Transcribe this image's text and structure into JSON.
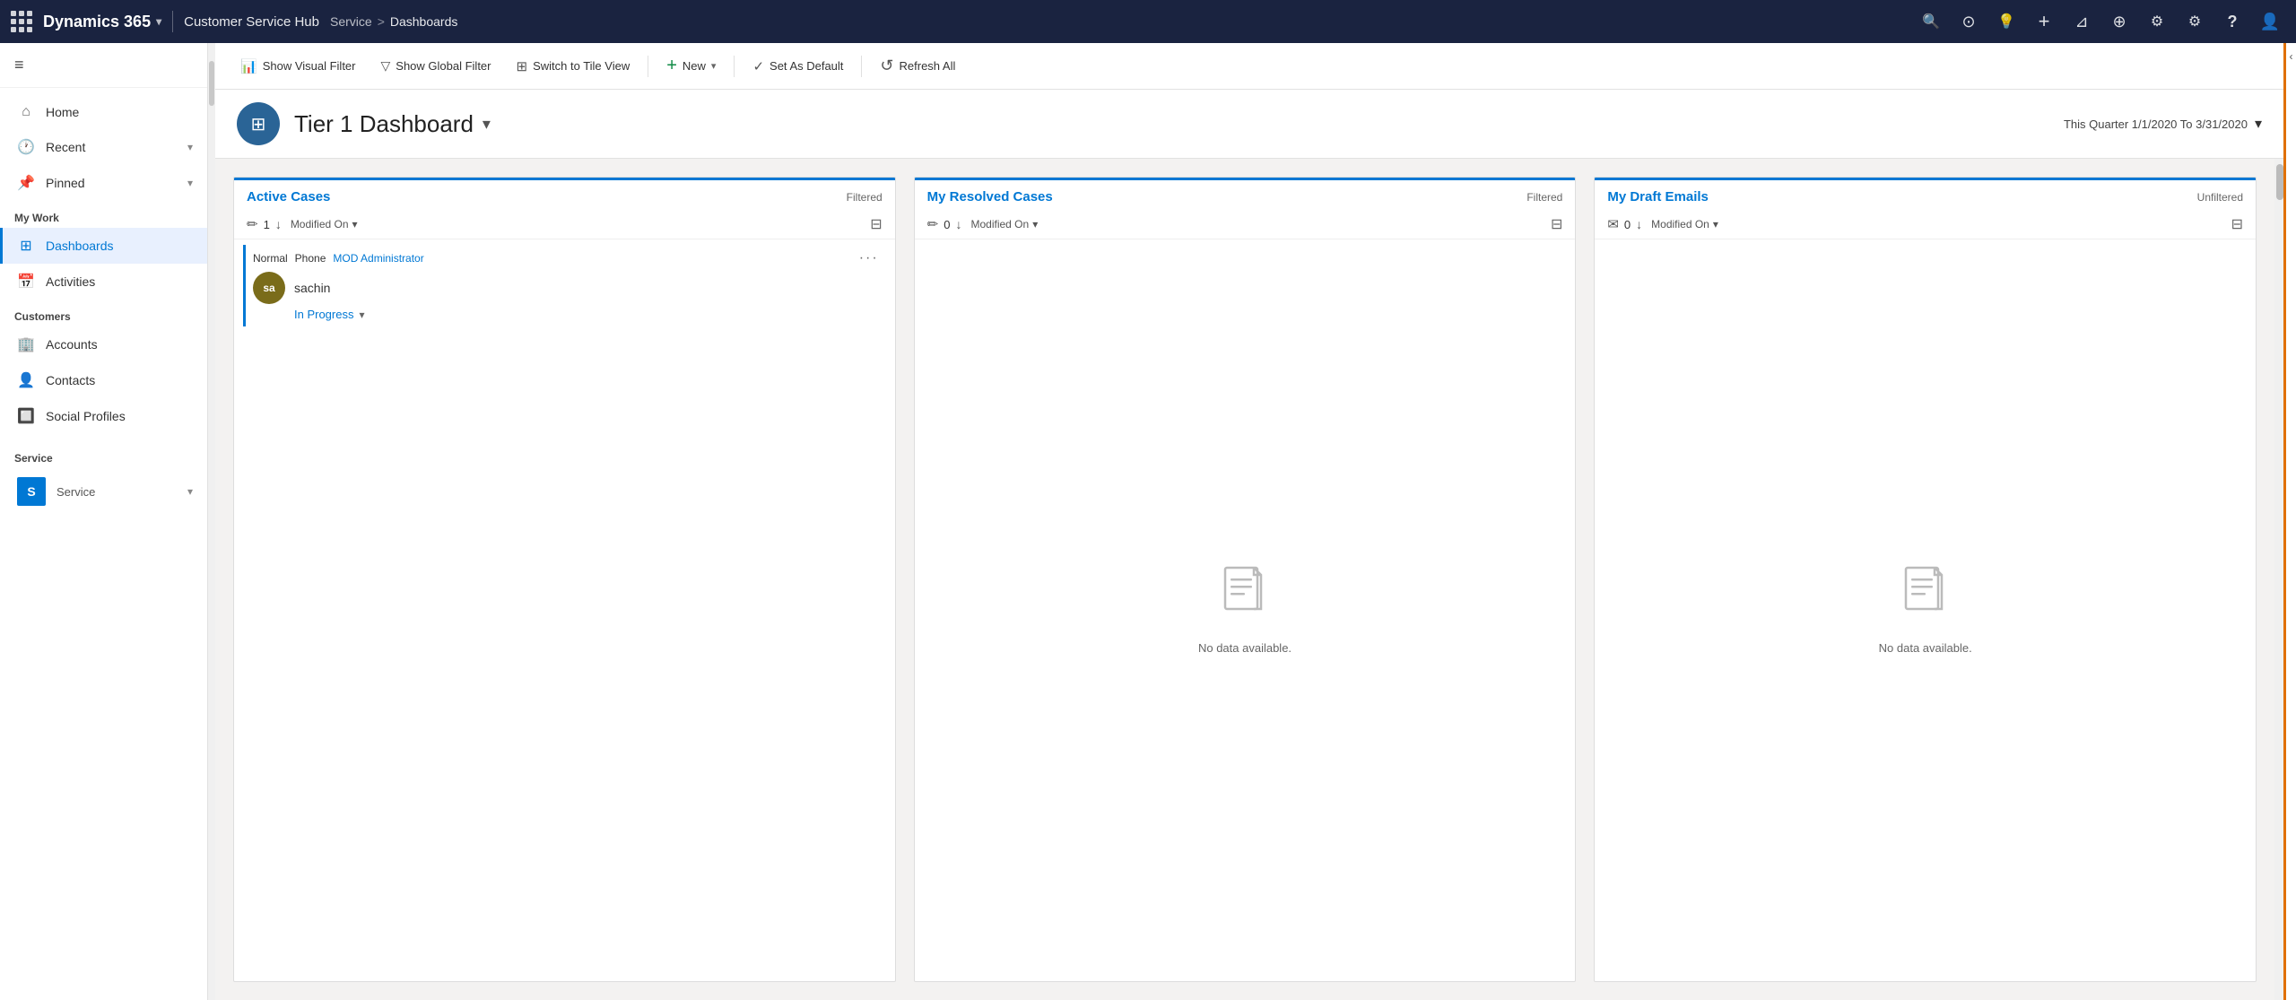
{
  "topNav": {
    "brandName": "Dynamics 365",
    "appName": "Customer Service Hub",
    "breadcrumb": {
      "service": "Service",
      "separator": ">",
      "current": "Dashboards"
    },
    "icons": [
      {
        "name": "search-icon",
        "symbol": "🔍"
      },
      {
        "name": "recent-activity-icon",
        "symbol": "⊙"
      },
      {
        "name": "lightbulb-icon",
        "symbol": "💡"
      },
      {
        "name": "plus-icon",
        "symbol": "+"
      },
      {
        "name": "filter-icon",
        "symbol": "⊿"
      },
      {
        "name": "circle-plus-icon",
        "symbol": "⊕"
      },
      {
        "name": "settings-alt-icon",
        "symbol": "⚙"
      },
      {
        "name": "gear-icon",
        "symbol": "⚙"
      },
      {
        "name": "help-icon",
        "symbol": "?"
      },
      {
        "name": "profile-icon",
        "symbol": "👤"
      }
    ]
  },
  "sidebar": {
    "toggleIcon": "≡",
    "navItems": [
      {
        "id": "home",
        "icon": "⌂",
        "label": "Home",
        "hasChevron": false
      },
      {
        "id": "recent",
        "icon": "🕐",
        "label": "Recent",
        "hasChevron": true
      },
      {
        "id": "pinned",
        "icon": "📌",
        "label": "Pinned",
        "hasChevron": true
      }
    ],
    "sections": [
      {
        "id": "my-work",
        "label": "My Work",
        "items": [
          {
            "id": "dashboards",
            "icon": "⊞",
            "label": "Dashboards",
            "active": true
          },
          {
            "id": "activities",
            "icon": "📅",
            "label": "Activities",
            "active": false
          }
        ]
      },
      {
        "id": "customers",
        "label": "Customers",
        "items": [
          {
            "id": "accounts",
            "icon": "🏢",
            "label": "Accounts",
            "active": false
          },
          {
            "id": "contacts",
            "icon": "👤",
            "label": "Contacts",
            "active": false
          },
          {
            "id": "social-profiles",
            "icon": "🔲",
            "label": "Social Profiles",
            "active": false
          }
        ]
      },
      {
        "id": "service",
        "label": "Service",
        "items": [
          {
            "id": "service-item",
            "label": "S",
            "active": false
          }
        ]
      }
    ]
  },
  "toolbar": {
    "buttons": [
      {
        "id": "show-visual-filter",
        "icon": "📊",
        "label": "Show Visual Filter"
      },
      {
        "id": "show-global-filter",
        "icon": "▽",
        "label": "Show Global Filter"
      },
      {
        "id": "switch-tile-view",
        "icon": "⊞",
        "label": "Switch to Tile View"
      },
      {
        "id": "new",
        "icon": "+",
        "label": "New",
        "hasChevron": true
      },
      {
        "id": "set-as-default",
        "icon": "✓",
        "label": "Set As Default"
      },
      {
        "id": "refresh-all",
        "icon": "↺",
        "label": "Refresh All"
      }
    ]
  },
  "dashboard": {
    "iconSymbol": "⊞",
    "title": "Tier 1 Dashboard",
    "dateRange": "This Quarter 1/1/2020 To 3/31/2020",
    "cards": [
      {
        "id": "active-cases",
        "title": "Active Cases",
        "filterStatus": "Filtered",
        "count": 1,
        "sortField": "Modified On",
        "items": [
          {
            "type": "Normal",
            "channel": "Phone",
            "owner": "MOD Administrator",
            "avatarInitials": "sa",
            "avatarColor": "#7a6c1a",
            "name": "sachin",
            "status": "In Progress"
          }
        ],
        "hasData": true
      },
      {
        "id": "my-resolved-cases",
        "title": "My Resolved Cases",
        "filterStatus": "Filtered",
        "count": 0,
        "sortField": "Modified On",
        "hasData": false,
        "noDataText": "No data available."
      },
      {
        "id": "my-draft-emails",
        "title": "My Draft Emails",
        "filterStatus": "Unfiltered",
        "count": 0,
        "sortField": "Modified On",
        "hasData": false,
        "noDataText": "No data available."
      }
    ]
  }
}
